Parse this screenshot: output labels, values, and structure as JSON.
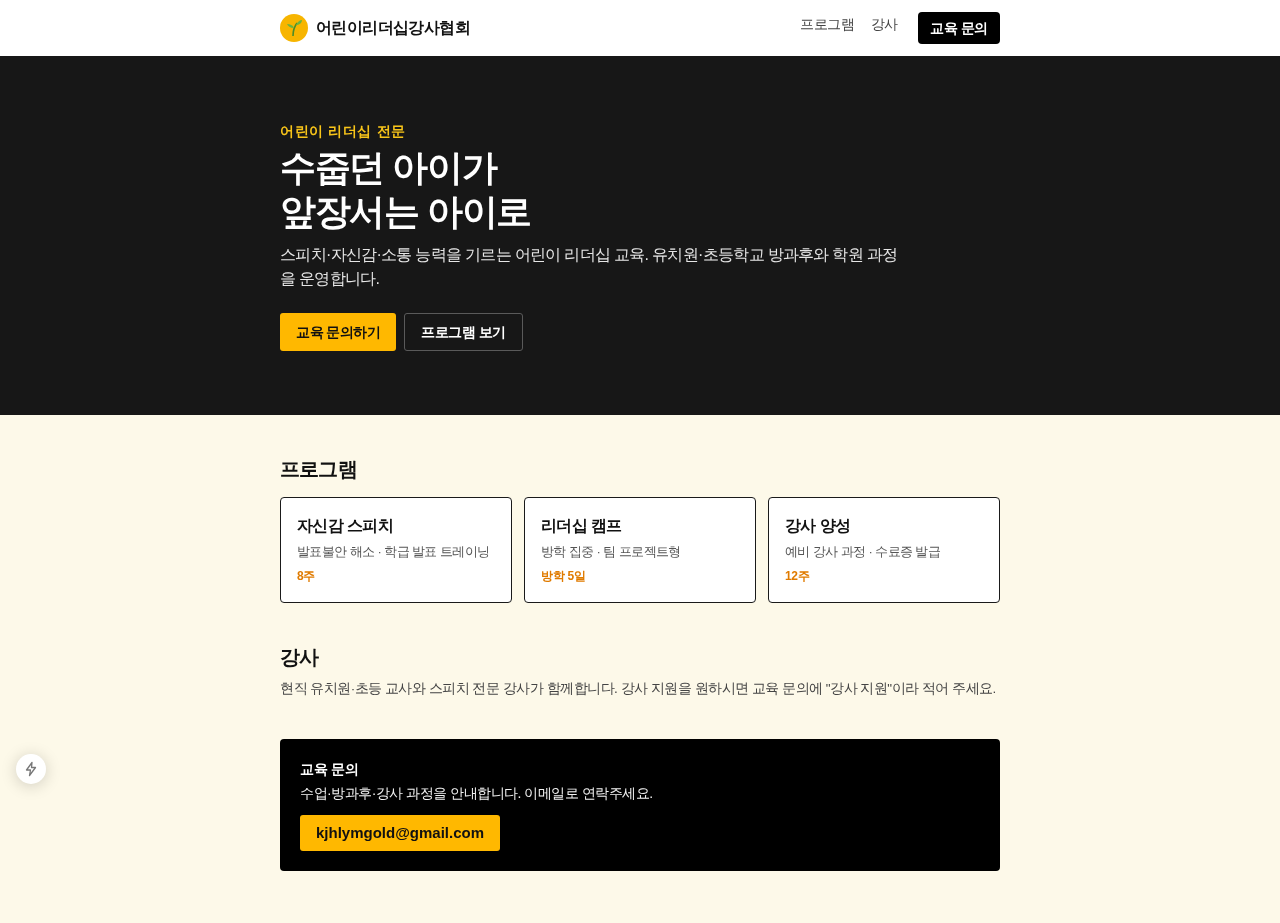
{
  "header": {
    "brand": "어린이리더십강사협회",
    "nav_links": [
      {
        "label": "프로그램"
      },
      {
        "label": "강사"
      }
    ],
    "cta": "교육 문의"
  },
  "hero": {
    "eyebrow": "어린이 리더십 전문",
    "title_lines": [
      "수줍던 아이가",
      "앞장서는 아이로"
    ],
    "description": "스피치·자신감·소통 능력을 기르는 어린이 리더십 교육. 유치원·초등학교 방과후와 학원 과정을 운영합니다.",
    "buttons": [
      {
        "label": "교육 문의하기",
        "kind": "primary"
      },
      {
        "label": "프로그램 보기",
        "kind": "outline"
      }
    ]
  },
  "programs": {
    "heading": "프로그램",
    "cards": [
      {
        "title": "자신감 스피치",
        "description": "발표불안 해소 · 학급 발표 트레이닝",
        "duration": "8주"
      },
      {
        "title": "리더십 캠프",
        "description": "방학 집중 · 팀 프로젝트형",
        "duration": "방학 5일"
      },
      {
        "title": "강사 양성",
        "description": "예비 강사 과정 · 수료증 발급",
        "duration": "12주"
      }
    ]
  },
  "instructors": {
    "heading": "강사",
    "text": "현직 유치원·초등 교사와 스피치 전문 강사가 함께합니다. 강사 지원을 원하시면 교육 문의에 \"강사 지원\"이라 적어 주세요."
  },
  "contact": {
    "heading": "교육 문의",
    "text": "수업·방과후·강사 과정을 안내합니다. 이메일로 연락주세요.",
    "email": "kjhlymgold@gmail.com"
  }
}
